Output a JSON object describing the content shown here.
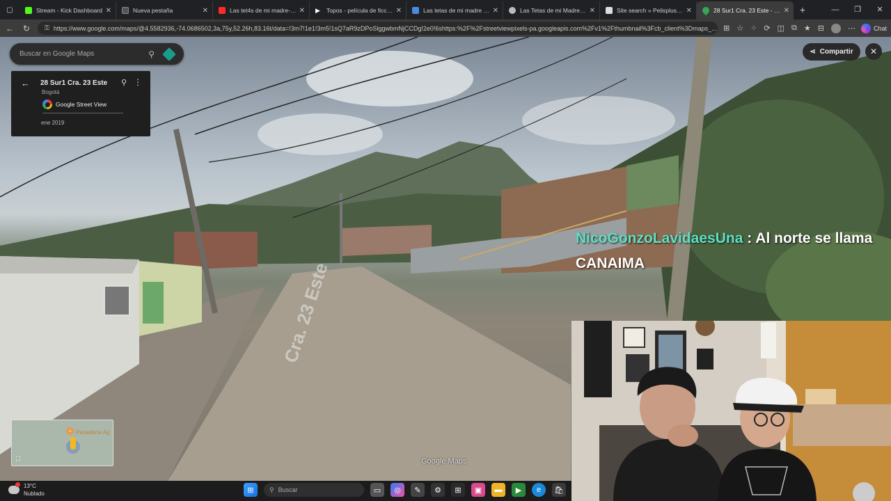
{
  "browser": {
    "tabs": [
      {
        "title": "Stream - Kick Dashboard",
        "color": "#53fc18"
      },
      {
        "title": "Nueva pestaña",
        "color": "#777777"
      },
      {
        "title": "Las tet4s de mi madre--pelíc",
        "color": "#ff2a2a"
      },
      {
        "title": "Topos - película de ficción co",
        "color": "#ffffff"
      },
      {
        "title": "Las tetas de mi madre (2015)",
        "color": "#4a8be0"
      },
      {
        "title": "Las Tetas de mi Madre - Pelí",
        "color": "#cccccc"
      },
      {
        "title": "Site search » Pelisplus - Ver P",
        "color": "#dddddd"
      },
      {
        "title": "28 Sur1 Cra. 23 Este - Googl",
        "color": "#34a853"
      }
    ],
    "url": "https://www.google.com/maps/@4.5582936,-74.0686502,3a,75y,52.26h,83.16t/data=!3m7!1e1!3m5!1sQ7aR9zDPoSlggwbmNjCCDg!2e0!6shttps:%2F%2Fstreetviewpixels-pa.googleapis.com%2Fv1%2Fthumbnail%3Fcb_client%3Dmaps_...",
    "chat_label": "Chat"
  },
  "maps": {
    "search_placeholder": "Buscar en Google Maps",
    "card": {
      "address": "28 Sur1 Cra. 23 Este",
      "city": "Bogotá",
      "source": "Google Street View",
      "date": "ene 2019"
    },
    "share_label": "Compartir",
    "minimap_label": "Panadería Ag",
    "watermark": "Google Maps",
    "street_sign": "Cra. 23 Este"
  },
  "overlay": {
    "username": "NicoGonzoLavidaesUna",
    "separator": " : ",
    "message": "Al norte se llama CANAIMA"
  },
  "taskbar": {
    "temperature": "13°C",
    "condition": "Nublado",
    "search_placeholder": "Buscar"
  }
}
